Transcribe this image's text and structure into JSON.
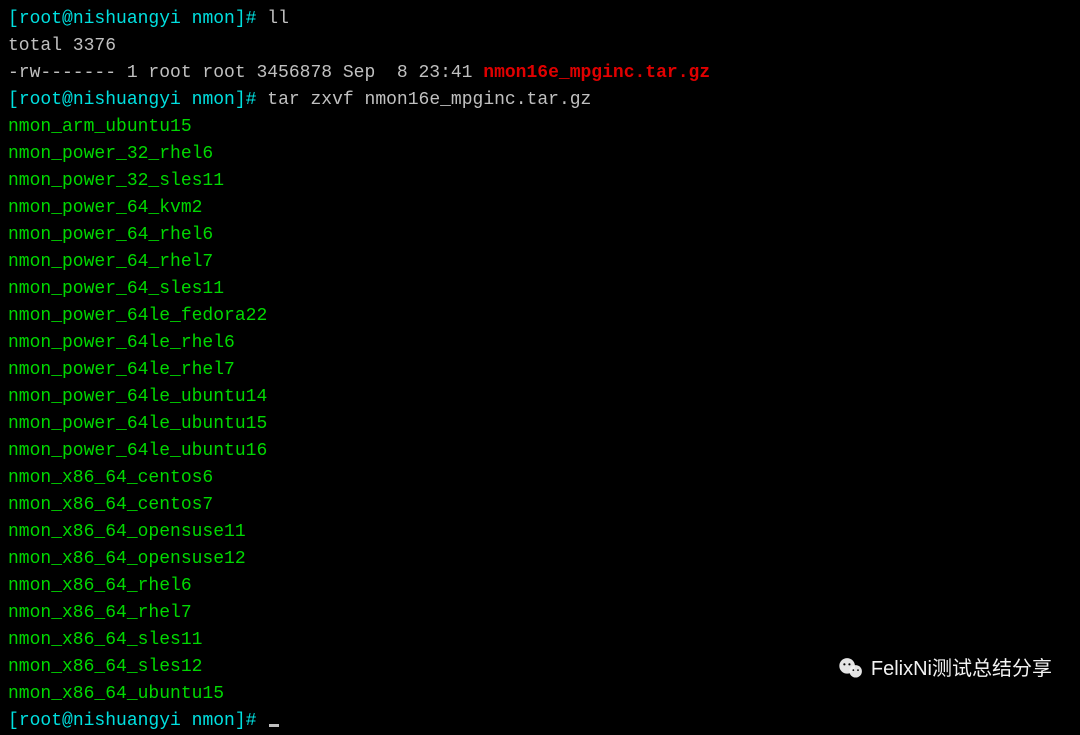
{
  "prompt": {
    "open": "[",
    "user_host": "root@nishuangyi",
    "space": " ",
    "dir": "nmon",
    "close": "]#",
    "trailing": " "
  },
  "commands": {
    "ll": "ll",
    "tar": "tar zxvf nmon16e_mpginc.tar.gz"
  },
  "ll_output": {
    "total_line": "total 3376",
    "entry_prefix": "-rw------- 1 root root 3456878 Sep  8 23:41 ",
    "entry_file": "nmon16e_mpginc.tar.gz"
  },
  "tar_files": [
    "nmon_arm_ubuntu15",
    "nmon_power_32_rhel6",
    "nmon_power_32_sles11",
    "nmon_power_64_kvm2",
    "nmon_power_64_rhel6",
    "nmon_power_64_rhel7",
    "nmon_power_64_sles11",
    "nmon_power_64le_fedora22",
    "nmon_power_64le_rhel6",
    "nmon_power_64le_rhel7",
    "nmon_power_64le_ubuntu14",
    "nmon_power_64le_ubuntu15",
    "nmon_power_64le_ubuntu16",
    "nmon_x86_64_centos6",
    "nmon_x86_64_centos7",
    "nmon_x86_64_opensuse11",
    "nmon_x86_64_opensuse12",
    "nmon_x86_64_rhel6",
    "nmon_x86_64_rhel7",
    "nmon_x86_64_sles11",
    "nmon_x86_64_sles12",
    "nmon_x86_64_ubuntu15"
  ],
  "watermark": {
    "text": "FelixNi测试总结分享"
  }
}
